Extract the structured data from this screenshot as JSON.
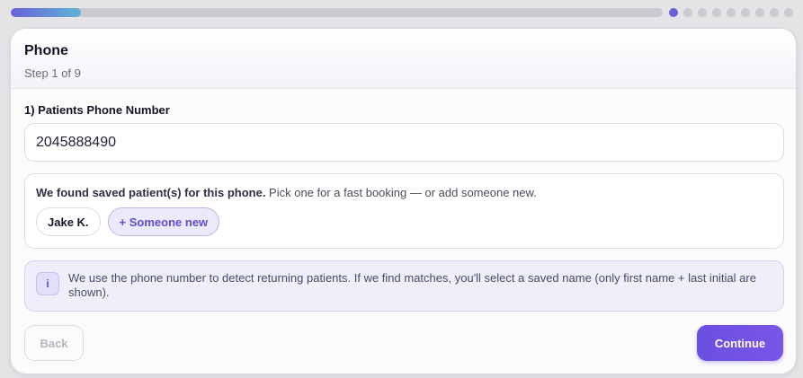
{
  "progress": {
    "fraction": 0.108,
    "total_steps": 9,
    "current_step": 1
  },
  "header": {
    "title": "Phone",
    "subtitle": "Step 1 of 9"
  },
  "phone": {
    "label": "1) Patients Phone Number",
    "value": "2045888490"
  },
  "found": {
    "bold": "We found saved patient(s) for this phone.",
    "rest": " Pick one for a fast booking — or add someone new.",
    "patients": [
      "Jake K."
    ],
    "add_new_label": "+ Someone new"
  },
  "info": {
    "icon": "info-icon",
    "glyph": "i",
    "text": "We use the phone number to detect returning patients. If we find matches, you'll select a saved name (only first name + last initial are shown)."
  },
  "actions": {
    "back_label": "Back",
    "continue_label": "Continue"
  },
  "colors": {
    "accent": "#6a4fe0",
    "progress_start": "#6a62d8",
    "progress_end": "#5fb4d4"
  }
}
